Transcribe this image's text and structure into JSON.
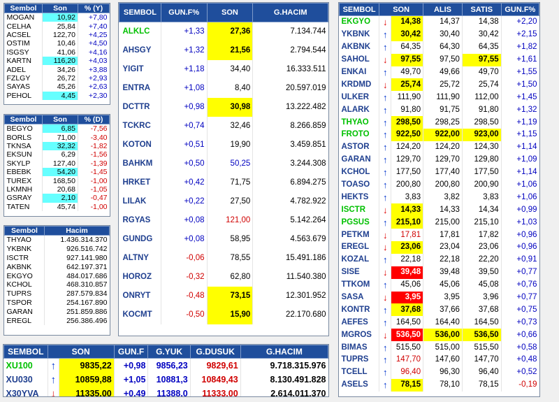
{
  "panel_top_movers": {
    "headers": [
      "Sembol",
      "Son",
      "% (Y)"
    ],
    "rows": [
      {
        "sym": "MOGAN",
        "son": "10,92",
        "pct": "+7,80",
        "hl": "cy"
      },
      {
        "sym": "CELHA",
        "son": "25,84",
        "pct": "+7,40",
        "hl": ""
      },
      {
        "sym": "ACSEL",
        "son": "122,70",
        "pct": "+4,25",
        "hl": ""
      },
      {
        "sym": "OSTIM",
        "son": "10,46",
        "pct": "+4,50",
        "hl": ""
      },
      {
        "sym": "ISGSY",
        "son": "41,06",
        "pct": "+4,16",
        "hl": ""
      },
      {
        "sym": "KARTN",
        "son": "116,20",
        "pct": "+4,03",
        "hl": "cy"
      },
      {
        "sym": "ADEL",
        "son": "34,26",
        "pct": "+3,88",
        "hl": ""
      },
      {
        "sym": "FZLGY",
        "son": "26,72",
        "pct": "+2,93",
        "hl": ""
      },
      {
        "sym": "SAYAS",
        "son": "45,26",
        "pct": "+2,63",
        "hl": ""
      },
      {
        "sym": "PEHOL",
        "son": "4,45",
        "pct": "+2,30",
        "hl": "cy"
      }
    ]
  },
  "panel_top_losers": {
    "headers": [
      "Sembol",
      "Son",
      "% (D)"
    ],
    "rows": [
      {
        "sym": "BEGYO",
        "son": "6,85",
        "pct": "-7,56",
        "hl": "cy"
      },
      {
        "sym": "BORLS",
        "son": "71,00",
        "pct": "-3,40",
        "hl": ""
      },
      {
        "sym": "TKNSA",
        "son": "32,32",
        "pct": "-1,82",
        "hl": "cy"
      },
      {
        "sym": "EKSUN",
        "son": "6,29",
        "pct": "-1,56",
        "hl": ""
      },
      {
        "sym": "SKYLP",
        "son": "127,40",
        "pct": "-1,39",
        "hl": ""
      },
      {
        "sym": "EBEBK",
        "son": "54,20",
        "pct": "-1,45",
        "hl": "cy"
      },
      {
        "sym": "TUREX",
        "son": "168,50",
        "pct": "-1,00",
        "hl": ""
      },
      {
        "sym": "LKMNH",
        "son": "20,68",
        "pct": "-1,05",
        "hl": ""
      },
      {
        "sym": "GSRAY",
        "son": "2,10",
        "pct": "-0,47",
        "hl": "cy"
      },
      {
        "sym": "TATEN",
        "son": "45,74",
        "pct": "-1,00",
        "hl": ""
      }
    ]
  },
  "panel_volume": {
    "headers": [
      "Sembol",
      "Hacim"
    ],
    "rows": [
      {
        "sym": "THYAO",
        "hacim": "1.436.314.370"
      },
      {
        "sym": "YKBNK",
        "hacim": "926.516.742"
      },
      {
        "sym": "ISCTR",
        "hacim": "927.141.980"
      },
      {
        "sym": "AKBNK",
        "hacim": "642.197.371"
      },
      {
        "sym": "EKGYO",
        "hacim": "484.017.686"
      },
      {
        "sym": "KCHOL",
        "hacim": "468.310.857"
      },
      {
        "sym": "TUPRS",
        "hacim": "287.579.834"
      },
      {
        "sym": "TSPOR",
        "hacim": "254.167.890"
      },
      {
        "sym": "GARAN",
        "hacim": "251.859.886"
      },
      {
        "sym": "EREGL",
        "hacim": "256.386.496"
      }
    ]
  },
  "panel_middle": {
    "headers": [
      "SEMBOL",
      "GUN.F%",
      "SON",
      "G.HACIM"
    ],
    "rows": [
      {
        "sym": "ALKLC",
        "pct": "+1,33",
        "son": "27,36",
        "hacim": "7.134.744",
        "hl": "y",
        "symc": "gr",
        "sonc": ""
      },
      {
        "sym": "AHSGY",
        "pct": "+1,32",
        "son": "21,56",
        "hacim": "2.794.544",
        "hl": "y",
        "symc": "",
        "sonc": ""
      },
      {
        "sym": "YIGIT",
        "pct": "+1,18",
        "son": "34,40",
        "hacim": "16.333.511",
        "hl": "",
        "symc": "",
        "sonc": ""
      },
      {
        "sym": "ENTRA",
        "pct": "+1,08",
        "son": "8,40",
        "hacim": "20.597.019",
        "hl": "",
        "symc": "",
        "sonc": ""
      },
      {
        "sym": "DCTTR",
        "pct": "+0,98",
        "son": "30,98",
        "hacim": "13.222.482",
        "hl": "y",
        "symc": "",
        "sonc": ""
      },
      {
        "sym": "TCKRC",
        "pct": "+0,74",
        "son": "32,46",
        "hacim": "8.266.859",
        "hl": "",
        "symc": "",
        "sonc": ""
      },
      {
        "sym": "KOTON",
        "pct": "+0,51",
        "son": "19,90",
        "hacim": "3.459.851",
        "hl": "",
        "symc": "",
        "sonc": ""
      },
      {
        "sym": "BAHKM",
        "pct": "+0,50",
        "son": "50,25",
        "hacim": "3.244.308",
        "hl": "",
        "symc": "",
        "sonc": "up"
      },
      {
        "sym": "HRKET",
        "pct": "+0,42",
        "son": "71,75",
        "hacim": "6.894.275",
        "hl": "",
        "symc": "",
        "sonc": ""
      },
      {
        "sym": "LILAK",
        "pct": "+0,22",
        "son": "27,50",
        "hacim": "4.782.922",
        "hl": "",
        "symc": "",
        "sonc": ""
      },
      {
        "sym": "RGYAS",
        "pct": "+0,08",
        "son": "121,00",
        "hacim": "5.142.264",
        "hl": "",
        "symc": "",
        "sonc": "dn"
      },
      {
        "sym": "GUNDG",
        "pct": "+0,08",
        "son": "58,95",
        "hacim": "4.563.679",
        "hl": "",
        "symc": "",
        "sonc": ""
      },
      {
        "sym": "ALTNY",
        "pct": "-0,06",
        "son": "78,55",
        "hacim": "15.491.186",
        "hl": "",
        "symc": "",
        "sonc": ""
      },
      {
        "sym": "HOROZ",
        "pct": "-0,32",
        "son": "62,80",
        "hacim": "11.540.380",
        "hl": "",
        "symc": "",
        "sonc": ""
      },
      {
        "sym": "ONRYT",
        "pct": "-0,48",
        "son": "73,15",
        "hacim": "12.301.952",
        "hl": "y",
        "symc": "",
        "sonc": ""
      },
      {
        "sym": "KOCMT",
        "pct": "-0,50",
        "son": "15,90",
        "hacim": "22.170.680",
        "hl": "y",
        "symc": "",
        "sonc": ""
      }
    ]
  },
  "panel_right": {
    "headers": [
      "SEMBOL",
      "SON",
      "ALIS",
      "SATIS",
      "GUN.F%"
    ],
    "rows": [
      {
        "sym": "EKGYO",
        "dir": "down",
        "son": "14,38",
        "alis": "14,37",
        "satis": "14,38",
        "pct": "+2,20",
        "sonhl": "y",
        "sathl": "",
        "symc": "gr",
        "sonc": ""
      },
      {
        "sym": "YKBNK",
        "dir": "up",
        "son": "30,42",
        "alis": "30,40",
        "satis": "30,42",
        "pct": "+2,15",
        "sonhl": "y",
        "sathl": "",
        "symc": "",
        "sonc": ""
      },
      {
        "sym": "AKBNK",
        "dir": "up",
        "son": "64,35",
        "alis": "64,30",
        "satis": "64,35",
        "pct": "+1,82",
        "sonhl": "",
        "sathl": "",
        "symc": "",
        "sonc": ""
      },
      {
        "sym": "SAHOL",
        "dir": "down",
        "son": "97,55",
        "alis": "97,50",
        "satis": "97,55",
        "pct": "+1,61",
        "sonhl": "y",
        "sathl": "y",
        "symc": "",
        "sonc": ""
      },
      {
        "sym": "ENKAI",
        "dir": "up",
        "son": "49,70",
        "alis": "49,66",
        "satis": "49,70",
        "pct": "+1,55",
        "sonhl": "",
        "sathl": "",
        "symc": "",
        "sonc": ""
      },
      {
        "sym": "KRDMD",
        "dir": "down",
        "son": "25,74",
        "alis": "25,72",
        "satis": "25,74",
        "pct": "+1,50",
        "sonhl": "y",
        "sathl": "",
        "symc": "",
        "sonc": ""
      },
      {
        "sym": "ULKER",
        "dir": "up",
        "son": "111,90",
        "alis": "111,90",
        "satis": "112,00",
        "pct": "+1,45",
        "sonhl": "",
        "sathl": "",
        "symc": "",
        "sonc": ""
      },
      {
        "sym": "ALARK",
        "dir": "up",
        "son": "91,80",
        "alis": "91,75",
        "satis": "91,80",
        "pct": "+1,32",
        "sonhl": "",
        "sathl": "",
        "symc": "",
        "sonc": ""
      },
      {
        "sym": "THYAO",
        "dir": "up",
        "son": "298,50",
        "alis": "298,25",
        "satis": "298,50",
        "pct": "+1,19",
        "sonhl": "y",
        "sathl": "",
        "symc": "gr",
        "sonc": ""
      },
      {
        "sym": "FROTO",
        "dir": "up",
        "son": "922,50",
        "alis": "922,00",
        "satis": "923,00",
        "pct": "+1,15",
        "sonhl": "y",
        "sathl": "y",
        "alishl": "y",
        "symc": "gr",
        "sonc": ""
      },
      {
        "sym": "ASTOR",
        "dir": "up",
        "son": "124,20",
        "alis": "124,20",
        "satis": "124,30",
        "pct": "+1,14",
        "sonhl": "",
        "sathl": "",
        "symc": "",
        "sonc": ""
      },
      {
        "sym": "GARAN",
        "dir": "up",
        "son": "129,70",
        "alis": "129,70",
        "satis": "129,80",
        "pct": "+1,09",
        "sonhl": "",
        "sathl": "",
        "symc": "",
        "sonc": ""
      },
      {
        "sym": "KCHOL",
        "dir": "up",
        "son": "177,50",
        "alis": "177,40",
        "satis": "177,50",
        "pct": "+1,14",
        "sonhl": "",
        "sathl": "",
        "symc": "",
        "sonc": ""
      },
      {
        "sym": "TOASO",
        "dir": "up",
        "son": "200,80",
        "alis": "200,80",
        "satis": "200,90",
        "pct": "+1,06",
        "sonhl": "",
        "sathl": "",
        "symc": "",
        "sonc": ""
      },
      {
        "sym": "HEKTS",
        "dir": "up",
        "son": "3,83",
        "alis": "3,82",
        "satis": "3,83",
        "pct": "+1,06",
        "sonhl": "",
        "sathl": "",
        "symc": "",
        "sonc": ""
      },
      {
        "sym": "ISCTR",
        "dir": "down",
        "son": "14,33",
        "alis": "14,33",
        "satis": "14,34",
        "pct": "+0,99",
        "sonhl": "y",
        "sathl": "",
        "symc": "gr",
        "sonc": ""
      },
      {
        "sym": "PGSUS",
        "dir": "up",
        "son": "215,10",
        "alis": "215,00",
        "satis": "215,10",
        "pct": "+1,03",
        "sonhl": "y",
        "sathl": "",
        "symc": "gr",
        "sonc": ""
      },
      {
        "sym": "PETKM",
        "dir": "down",
        "son": "17,81",
        "alis": "17,81",
        "satis": "17,82",
        "pct": "+0,96",
        "sonhl": "",
        "sathl": "",
        "symc": "",
        "sonc": "dn"
      },
      {
        "sym": "EREGL",
        "dir": "down",
        "son": "23,06",
        "alis": "23,04",
        "satis": "23,06",
        "pct": "+0,96",
        "sonhl": "y",
        "sathl": "",
        "symc": "",
        "sonc": ""
      },
      {
        "sym": "KOZAL",
        "dir": "up",
        "son": "22,18",
        "alis": "22,18",
        "satis": "22,20",
        "pct": "+0,91",
        "sonhl": "",
        "sathl": "",
        "symc": "",
        "sonc": ""
      },
      {
        "sym": "SISE",
        "dir": "down",
        "son": "39,48",
        "alis": "39,48",
        "satis": "39,50",
        "pct": "+0,77",
        "sonhl": "rd",
        "sathl": "",
        "symc": "",
        "sonc": ""
      },
      {
        "sym": "TTKOM",
        "dir": "up",
        "son": "45,06",
        "alis": "45,06",
        "satis": "45,08",
        "pct": "+0,76",
        "sonhl": "",
        "sathl": "",
        "symc": "",
        "sonc": ""
      },
      {
        "sym": "SASA",
        "dir": "down",
        "son": "3,95",
        "alis": "3,95",
        "satis": "3,96",
        "pct": "+0,77",
        "sonhl": "rd",
        "sathl": "",
        "symc": "",
        "sonc": ""
      },
      {
        "sym": "KONTR",
        "dir": "up",
        "son": "37,68",
        "alis": "37,66",
        "satis": "37,68",
        "pct": "+0,75",
        "sonhl": "y",
        "sathl": "",
        "symc": "",
        "sonc": ""
      },
      {
        "sym": "AEFES",
        "dir": "up",
        "son": "164,50",
        "alis": "164,40",
        "satis": "164,50",
        "pct": "+0,73",
        "sonhl": "",
        "sathl": "",
        "symc": "",
        "sonc": ""
      },
      {
        "sym": "MGROS",
        "dir": "down",
        "son": "536,50",
        "alis": "536,00",
        "satis": "536,50",
        "pct": "+0,66",
        "sonhl": "rd",
        "sathl": "y",
        "alishl": "y",
        "symc": "",
        "sonc": ""
      },
      {
        "sym": "BIMAS",
        "dir": "up",
        "son": "515,50",
        "alis": "515,00",
        "satis": "515,50",
        "pct": "+0,58",
        "sonhl": "",
        "sathl": "",
        "symc": "",
        "sonc": ""
      },
      {
        "sym": "TUPRS",
        "dir": "up",
        "son": "147,70",
        "alis": "147,60",
        "satis": "147,70",
        "pct": "+0,48",
        "sonhl": "",
        "sathl": "",
        "symc": "",
        "sonc": "dn"
      },
      {
        "sym": "TCELL",
        "dir": "up",
        "son": "96,40",
        "alis": "96,30",
        "satis": "96,40",
        "pct": "+0,52",
        "sonhl": "",
        "sathl": "",
        "symc": "",
        "sonc": "dn"
      },
      {
        "sym": "ASELS",
        "dir": "up",
        "son": "78,15",
        "alis": "78,10",
        "satis": "78,15",
        "pct": "-0,19",
        "sonhl": "y",
        "sathl": "",
        "symc": "",
        "sonc": ""
      }
    ]
  },
  "panel_indices": {
    "headers": [
      "SEMBOL",
      "SON",
      "GUN.F",
      "G.YUK",
      "G.DUSUK",
      "G.HACIM"
    ],
    "rows": [
      {
        "sym": "XU100",
        "dir": "up",
        "son": "9835,22",
        "pct": "+0,98",
        "yuk": "9856,23",
        "dusuk": "9829,61",
        "hacim": "9.718.315.976",
        "symc": "gr"
      },
      {
        "sym": "XU030",
        "dir": "up",
        "son": "10859,88",
        "pct": "+1,05",
        "yuk": "10881,3",
        "dusuk": "10849,43",
        "hacim": "8.130.491.828",
        "symc": ""
      },
      {
        "sym": "X30YVA",
        "dir": "down",
        "son": "11335,00",
        "pct": "+0,49",
        "yuk": "11388,0",
        "dusuk": "11333,00",
        "hacim": "2.614.011.370",
        "symc": ""
      }
    ]
  },
  "icons": {
    "up": "↑",
    "down": "↓"
  }
}
